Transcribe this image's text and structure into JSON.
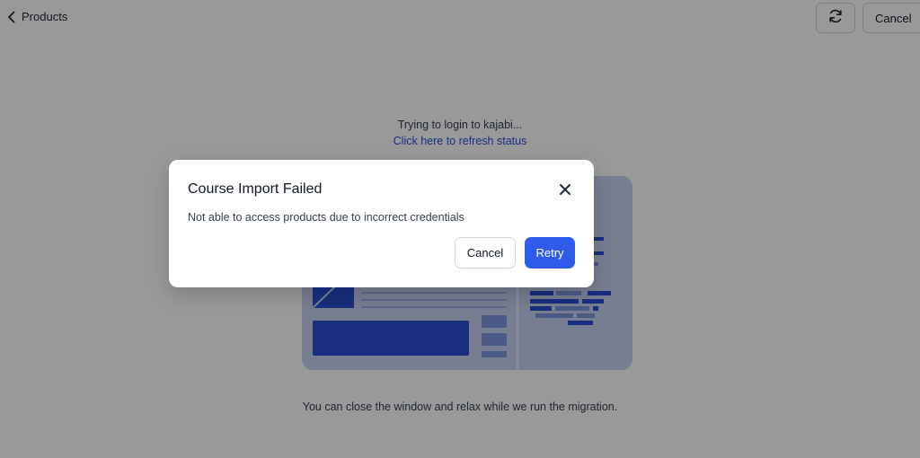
{
  "header": {
    "back_label": "Products",
    "back_icon": "chevron-left-icon",
    "refresh_icon": "refresh-icon",
    "cancel_label": "Cancel"
  },
  "status": {
    "message": "Trying to login to kajabi...",
    "refresh_link": "Click here to refresh status"
  },
  "footer": {
    "note": "You can close the window and relax while we run the migration."
  },
  "modal": {
    "title": "Course Import Failed",
    "message": "Not able to access products due to incorrect credentials",
    "close_icon": "close-icon",
    "cancel_label": "Cancel",
    "retry_label": "Retry"
  },
  "colors": {
    "accent": "#2f5bea",
    "link": "#2b50d8",
    "illustration_fill": "#c9d3f2",
    "illustration_dark": "#2a4ed4"
  }
}
